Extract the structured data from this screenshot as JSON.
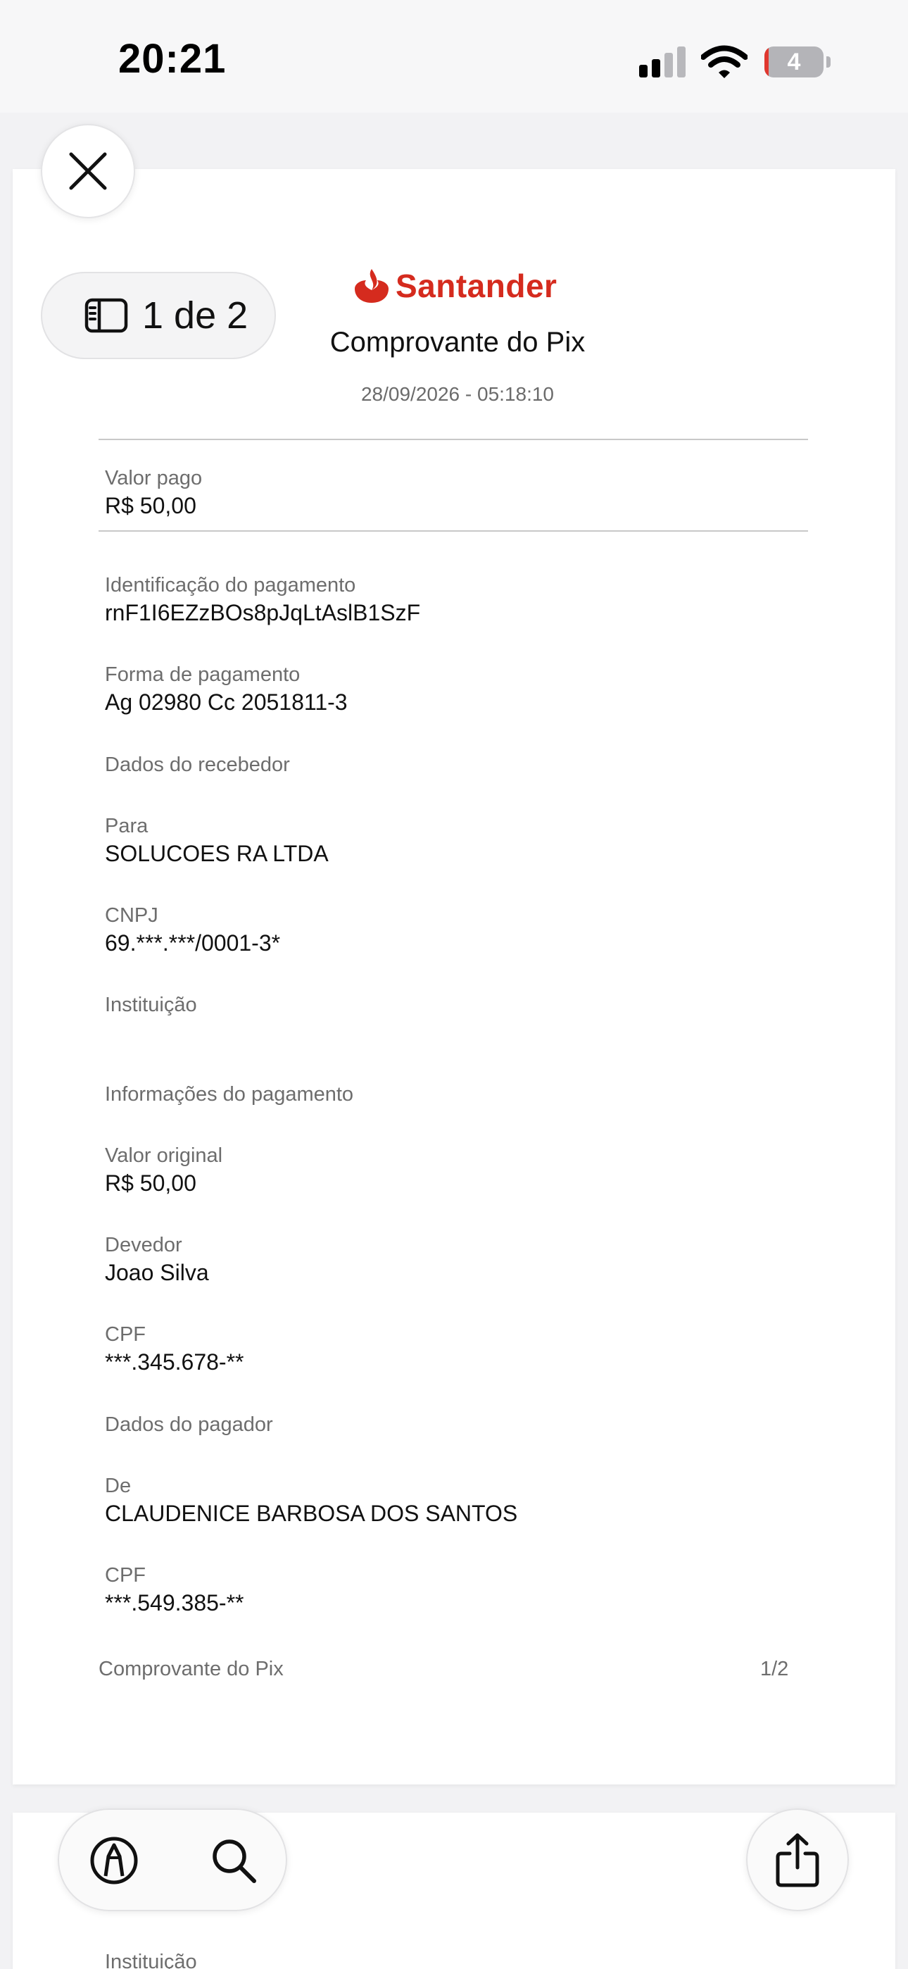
{
  "status_bar": {
    "time": "20:21",
    "battery": "4"
  },
  "toolbar": {
    "page_indicator": "1 de 2",
    "close_icon": "close-icon",
    "sidebar_icon": "sidebar-icon",
    "markup_icon": "markup-pen-icon",
    "search_icon": "search-icon",
    "share_icon": "share-icon"
  },
  "document": {
    "brand": "Santander",
    "brand_color": "#d52b1e",
    "title": "Comprovante do Pix",
    "datetime": "28/09/2026 - 05:18:10",
    "valor_pago": {
      "label": "Valor pago",
      "value": "R$ 50,00"
    },
    "identificacao": {
      "label": "Identificação do pagamento",
      "value": "rnF1I6EZzBOs8pJqLtAslB1SzF"
    },
    "forma_pagamento": {
      "label": "Forma de pagamento",
      "value": "Ag 02980 Cc 2051811-3"
    },
    "recebedor": {
      "section": "Dados do recebedor",
      "para_label": "Para",
      "para_value": "SOLUCOES RA LTDA",
      "cnpj_label": "CNPJ",
      "cnpj_value": "69.***.***/0001-3*",
      "instituicao_label": "Instituição"
    },
    "informacoes": {
      "section": "Informações do pagamento",
      "valor_original_label": "Valor original",
      "valor_original_value": "R$ 50,00",
      "devedor_label": "Devedor",
      "devedor_value": "Joao Silva",
      "cpf_label": "CPF",
      "cpf_value": "***.345.678-**"
    },
    "pagador": {
      "section": "Dados do pagador",
      "de_label": "De",
      "de_value": "CLAUDENICE BARBOSA DOS SANTOS",
      "cpf_label": "CPF",
      "cpf_value": "***.549.385-**"
    },
    "footer_left": "Comprovante do Pix",
    "footer_right": "1/2"
  },
  "next_page": {
    "peek_label": "Instituição"
  }
}
